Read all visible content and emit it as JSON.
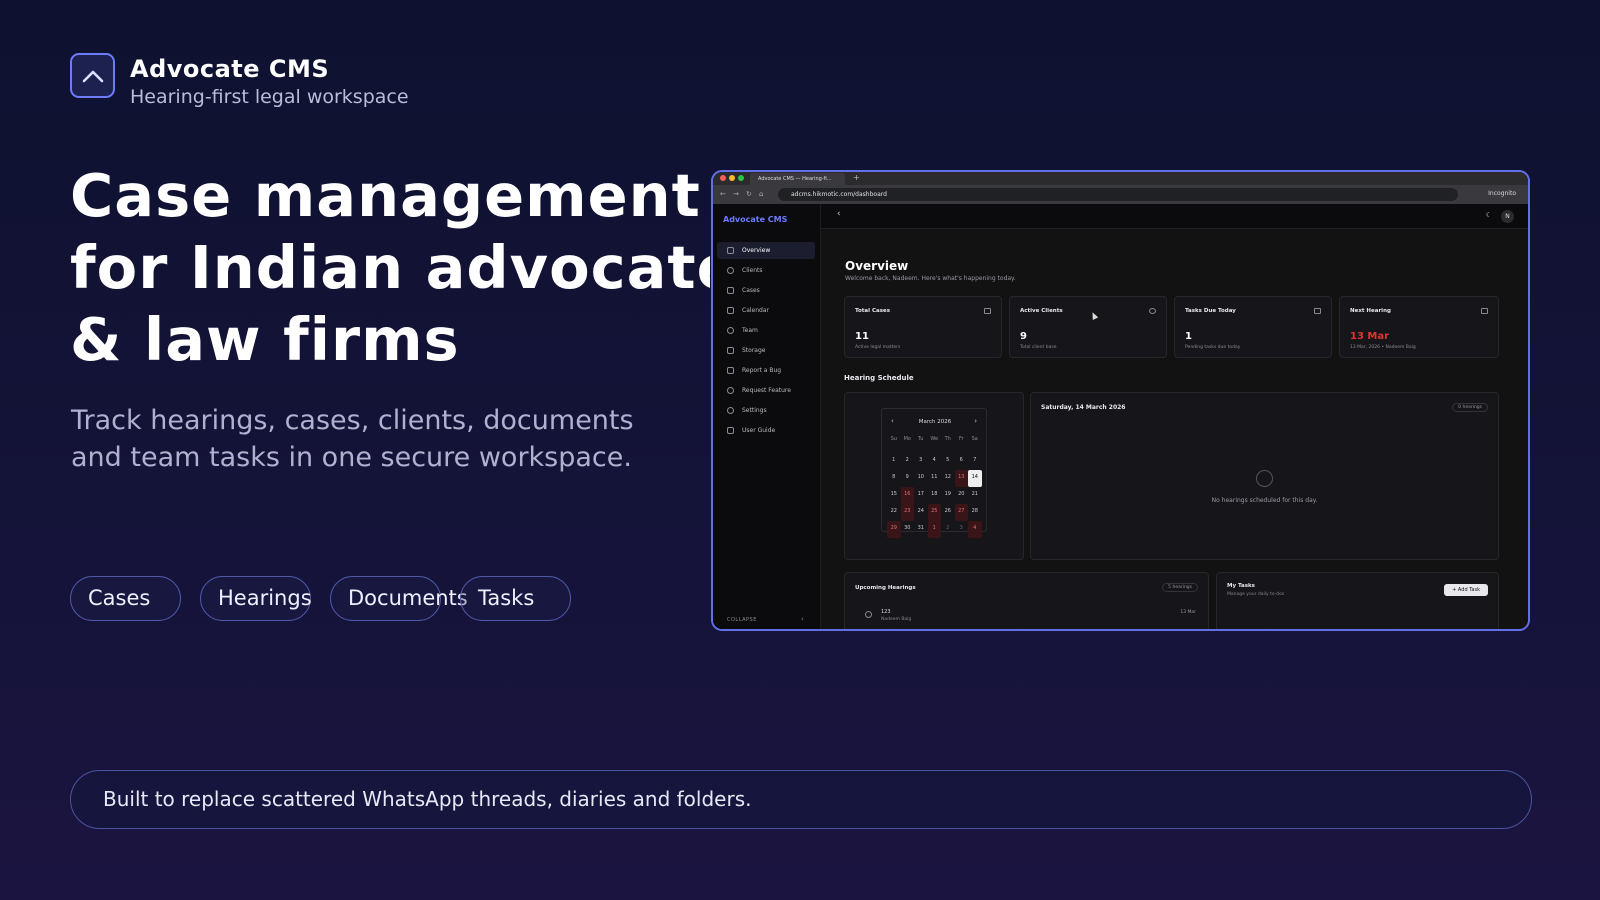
{
  "brand": {
    "title": "Advocate CMS",
    "subtitle": "Hearing-first legal workspace",
    "logo_icon": "chevron-up-icon"
  },
  "hero": {
    "title_lines": [
      "Case management",
      "for Indian advocates",
      "& law firms"
    ],
    "description": "Track hearings, cases, clients, documents and team tasks in one secure workspace."
  },
  "pills": [
    "Cases",
    "Hearings",
    "Documents",
    "Tasks"
  ],
  "footer": {
    "text": "Built to replace scattered WhatsApp threads, diaries and folders."
  },
  "colors": {
    "accent": "#6d7bff",
    "background": "#111432",
    "alert_red": "#e5322f"
  },
  "screenshot": {
    "browser": {
      "tab_title": "Advocate CMS — Hearing-fi...",
      "url": "adcms.hikmotic.com/dashboard",
      "mode": "Incognito"
    },
    "sidebar": {
      "brand": "Advocate CMS",
      "items": [
        {
          "label": "Overview",
          "icon": "grid-icon",
          "active": true
        },
        {
          "label": "Clients",
          "icon": "users-icon"
        },
        {
          "label": "Cases",
          "icon": "briefcase-icon"
        },
        {
          "label": "Calendar",
          "icon": "calendar-icon"
        },
        {
          "label": "Team",
          "icon": "team-icon"
        },
        {
          "label": "Storage",
          "icon": "storage-icon"
        },
        {
          "label": "Report a Bug",
          "icon": "bug-icon"
        },
        {
          "label": "Request Feature",
          "icon": "lightbulb-icon"
        },
        {
          "label": "Settings",
          "icon": "gear-icon"
        },
        {
          "label": "User Guide",
          "icon": "book-icon"
        }
      ],
      "collapse_label": "COLLAPSE"
    },
    "avatar_initial": "N",
    "overview": {
      "title": "Overview",
      "subtitle": "Welcome back, Nadeem. Here's what's happening today."
    },
    "stats": [
      {
        "title": "Total Cases",
        "value": "11",
        "note": "Active legal matters",
        "icon": "briefcase-icon"
      },
      {
        "title": "Active Clients",
        "value": "9",
        "note": "Total client base",
        "icon": "users-icon"
      },
      {
        "title": "Tasks Due Today",
        "value": "1",
        "note": "Pending tasks due today",
        "icon": "checklist-icon"
      },
      {
        "title": "Next Hearing",
        "value": "13 Mar",
        "note": "13 Mar, 2026 • Nadeem Baig",
        "icon": "calendar-icon",
        "alert": true
      }
    ],
    "hearing_schedule": {
      "title": "Hearing Schedule",
      "calendar": {
        "month": "March 2026",
        "weekdays": [
          "Su",
          "Mo",
          "Tu",
          "We",
          "Th",
          "Fr",
          "Sa"
        ],
        "days": [
          "1",
          "2",
          "3",
          "4",
          "5",
          "6",
          "7",
          "8",
          "9",
          "10",
          "11",
          "12",
          "13",
          "14",
          "15",
          "16",
          "17",
          "18",
          "19",
          "20",
          "21",
          "22",
          "23",
          "24",
          "25",
          "26",
          "27",
          "28",
          "29",
          "30",
          "31",
          "1",
          "2",
          "3",
          "4"
        ],
        "highlighted": [
          "13",
          "16",
          "23",
          "25",
          "27",
          "29",
          "1",
          "4"
        ],
        "today": "14"
      },
      "selected_date": "Saturday, 14 March 2026",
      "hearing_count": "0 hearings",
      "empty_message": "No hearings scheduled for this day."
    },
    "upcoming": {
      "title": "Upcoming Hearings",
      "count": "5 hearings",
      "first_case": "123",
      "first_client": "Nadeem Baig",
      "first_date": "13 Mar"
    },
    "tasks": {
      "title": "My Tasks",
      "subtitle": "Manage your daily to-dos",
      "add_label": "+ Add Task"
    }
  }
}
